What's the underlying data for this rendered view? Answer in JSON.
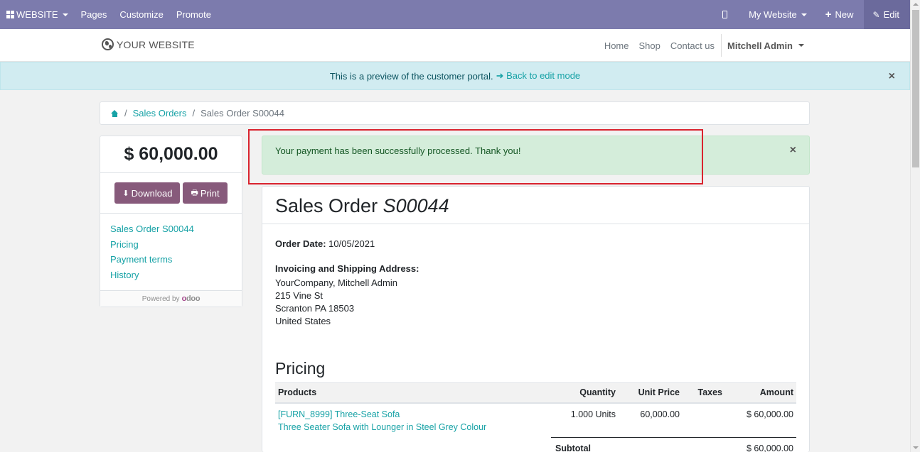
{
  "admin_bar": {
    "website_menu": "WEBSITE",
    "pages": "Pages",
    "customize": "Customize",
    "promote": "Promote",
    "my_website": "My Website",
    "new": "New",
    "edit": "Edit"
  },
  "site": {
    "logo_text": "YOUR WEBSITE",
    "nav": [
      "Home",
      "Shop",
      "Contact us"
    ],
    "user": "Mitchell Admin"
  },
  "preview_alert": {
    "text": "This is a preview of the customer portal.",
    "link": "Back to edit mode",
    "close": "×"
  },
  "breadcrumb": {
    "items": [
      "Sales Orders",
      "Sales Order S00044"
    ]
  },
  "sidebar": {
    "total": "$ 60,000.00",
    "download": "Download",
    "print": "Print",
    "links": [
      "Sales Order S00044",
      "Pricing",
      "Payment terms",
      "History"
    ],
    "powered_by": "Powered by"
  },
  "success_alert": {
    "text": "Your payment has been successfully processed. Thank you!",
    "close": "×"
  },
  "order": {
    "title_prefix": "Sales Order",
    "number": "S00044",
    "date_label": "Order Date:",
    "date_value": "10/05/2021",
    "address_title": "Invoicing and Shipping Address:",
    "address_lines": [
      "YourCompany, Mitchell Admin",
      "215 Vine St",
      "Scranton PA 18503",
      "United States"
    ],
    "pricing_title": "Pricing",
    "columns": [
      "Products",
      "Quantity",
      "Unit Price",
      "Taxes",
      "Amount"
    ],
    "lines": [
      {
        "product_line1": "[FURN_8999] Three-Seat Sofa",
        "product_line2": "Three Seater Sofa with Lounger in Steel Grey Colour",
        "quantity": "1.000 Units",
        "unit_price": "60,000.00",
        "taxes": "",
        "amount": "$ 60,000.00"
      }
    ],
    "subtotal_label": "Subtotal",
    "subtotal_value": "$ 60,000.00"
  }
}
